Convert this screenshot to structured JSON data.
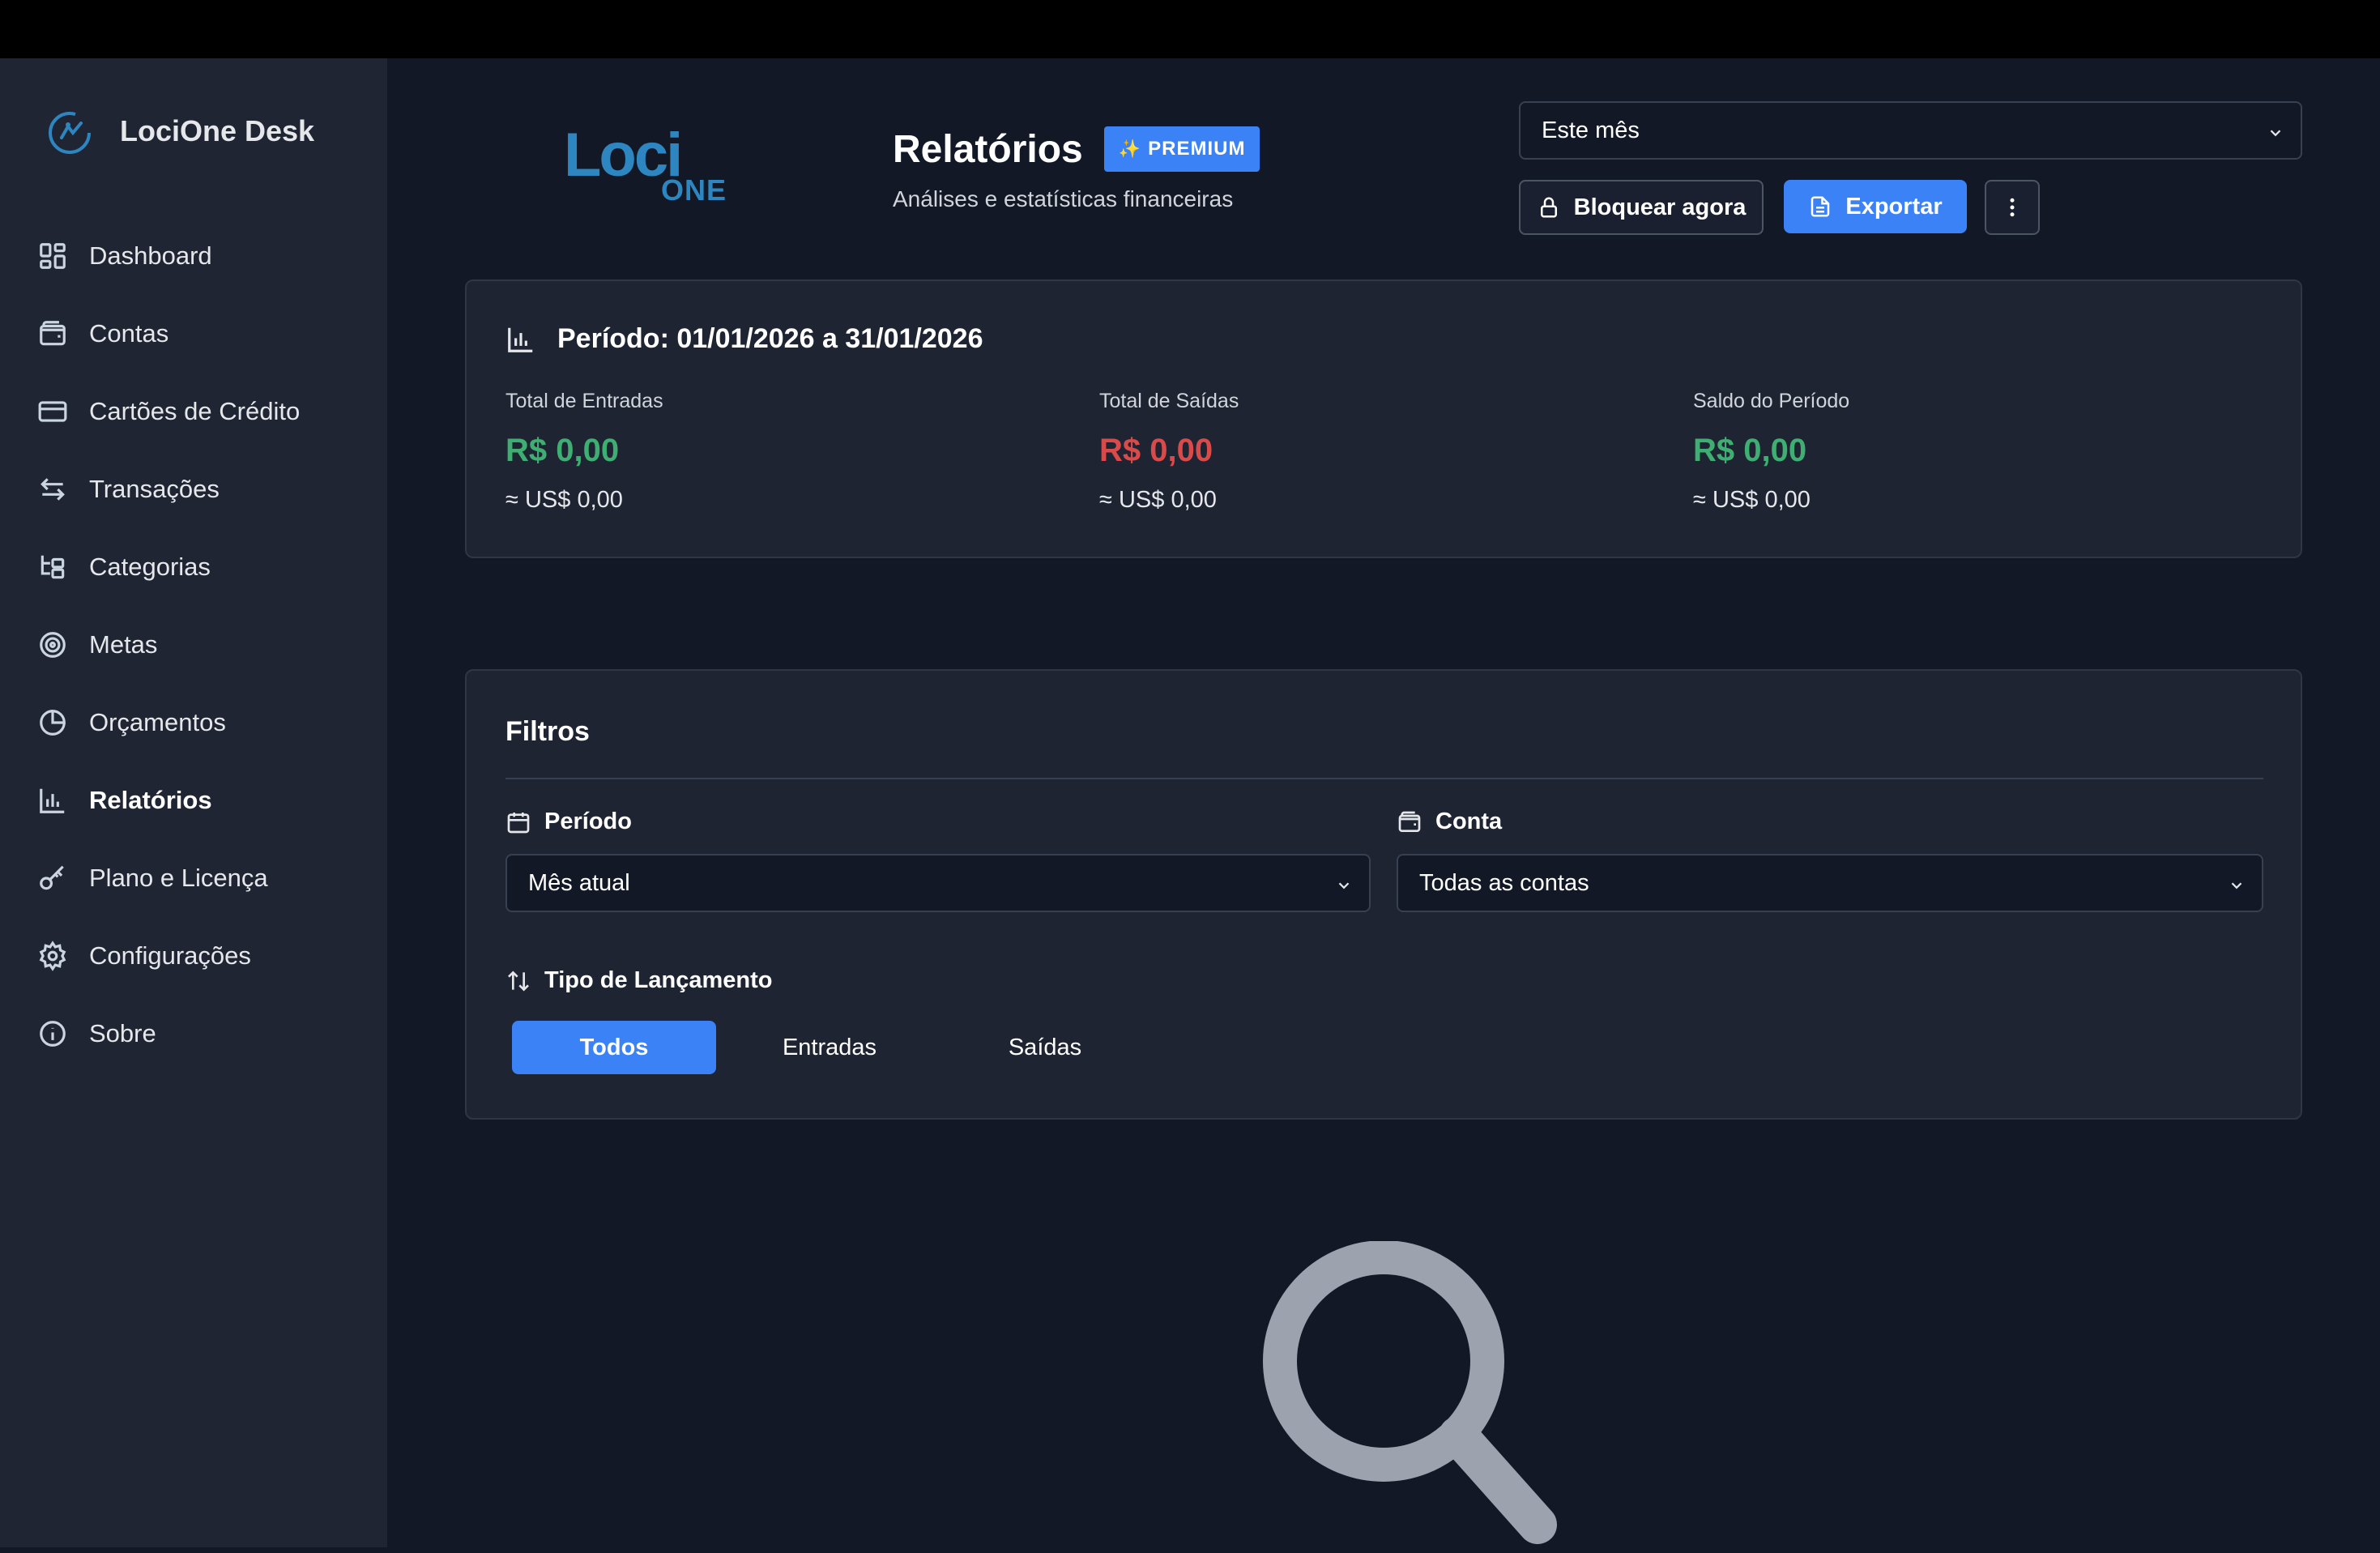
{
  "app": {
    "name": "LociOne Desk"
  },
  "sidebar": {
    "items": [
      {
        "label": "Dashboard",
        "icon": "dashboard-icon"
      },
      {
        "label": "Contas",
        "icon": "wallet-icon"
      },
      {
        "label": "Cartões de Crédito",
        "icon": "credit-card-icon"
      },
      {
        "label": "Transações",
        "icon": "arrows-swap-icon"
      },
      {
        "label": "Categorias",
        "icon": "category-tree-icon"
      },
      {
        "label": "Metas",
        "icon": "target-icon"
      },
      {
        "label": "Orçamentos",
        "icon": "pie-chart-icon"
      },
      {
        "label": "Relatórios",
        "icon": "bar-chart-icon",
        "active": true
      },
      {
        "label": "Plano e Licença",
        "icon": "key-icon"
      },
      {
        "label": "Configurações",
        "icon": "gear-icon"
      },
      {
        "label": "Sobre",
        "icon": "info-icon"
      }
    ]
  },
  "logo": {
    "loci": "Loci",
    "one": "ONE"
  },
  "header": {
    "title": "Relatórios",
    "badge": "PREMIUM",
    "subtitle": "Análises e estatísticas financeiras",
    "period_select": "Este mês",
    "lock_button": "Bloquear agora",
    "export_button": "Exportar"
  },
  "summary": {
    "title": "Período: 01/01/2026 a 31/01/2026",
    "metrics": [
      {
        "label": "Total de Entradas",
        "value": "R$ 0,00",
        "sub": "≈ US$ 0,00",
        "color": "#3fae72"
      },
      {
        "label": "Total de Saídas",
        "value": "R$ 0,00",
        "sub": "≈ US$ 0,00",
        "color": "#d94b4b"
      },
      {
        "label": "Saldo do Período",
        "value": "R$ 0,00",
        "sub": "≈ US$ 0,00",
        "color": "#3fae72"
      }
    ]
  },
  "filters": {
    "title": "Filtros",
    "period_label": "Período",
    "period_value": "Mês atual",
    "account_label": "Conta",
    "account_value": "Todas as contas",
    "type_label": "Tipo de Lançamento",
    "type_options": [
      "Todos",
      "Entradas",
      "Saídas"
    ],
    "type_selected": "Todos"
  },
  "colors": {
    "accent": "#3b82f6",
    "income": "#3fae72",
    "expense": "#d94b4b"
  }
}
